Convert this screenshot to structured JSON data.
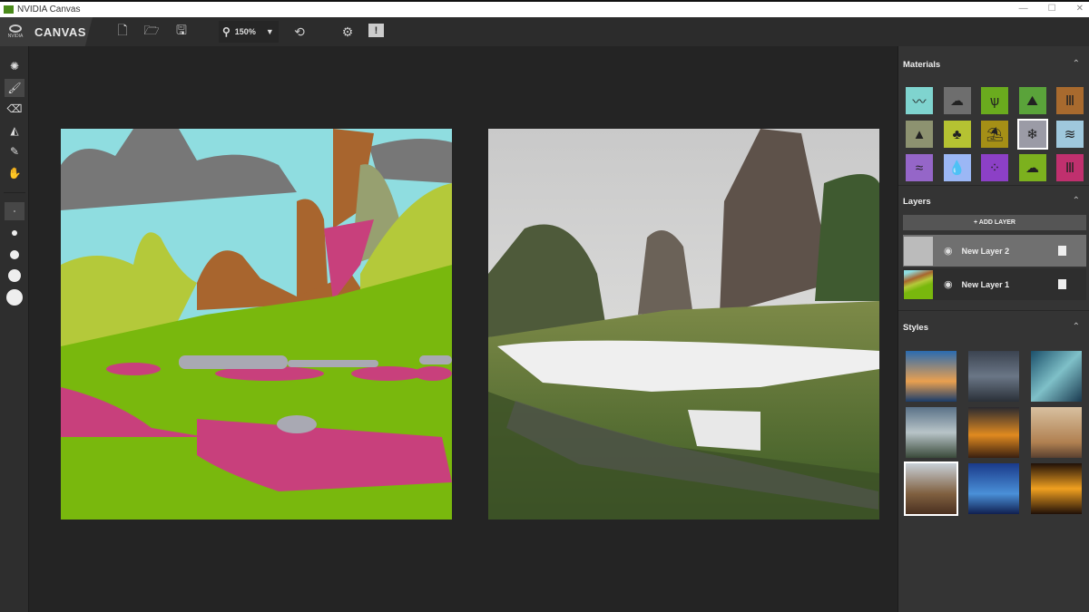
{
  "window": {
    "title": "NVIDIA Canvas",
    "controls": [
      "—",
      "☐",
      "✕"
    ]
  },
  "toolbar": {
    "brand": "NVIDIA",
    "app_name": "CANVAS",
    "zoom_level": "150%",
    "icons": [
      "new-file-icon",
      "open-folder-icon",
      "save-icon",
      "search-icon",
      "reset-icon",
      "gear-icon",
      "feedback-icon"
    ]
  },
  "left_tools": {
    "tools": [
      "material-icon",
      "brush-icon",
      "eraser-icon",
      "fill-bucket-icon",
      "eyedropper-icon",
      "hand-icon"
    ],
    "selected_tool": "brush",
    "brush_sizes": 5,
    "selected_brush_size": 1
  },
  "panel": {
    "materials": {
      "title": "Materials",
      "items": [
        {
          "name": "sky",
          "color": "#7fd4cf",
          "glyph": "〰"
        },
        {
          "name": "cloud",
          "color": "#6e6e6e",
          "glyph": "☁"
        },
        {
          "name": "grass",
          "color": "#6aab1e",
          "glyph": "ѱ"
        },
        {
          "name": "bush",
          "color": "#5aa33a",
          "glyph": "⛰"
        },
        {
          "name": "cliff",
          "color": "#a86a2e",
          "glyph": "Ⅲ"
        },
        {
          "name": "mountain",
          "color": "#8d9270",
          "glyph": "▲"
        },
        {
          "name": "tree",
          "color": "#b5c232",
          "glyph": "♣"
        },
        {
          "name": "beach",
          "color": "#a58f16",
          "glyph": "⛱"
        },
        {
          "name": "snow",
          "color": "#9b9ba6",
          "glyph": "❄"
        },
        {
          "name": "sea",
          "color": "#9fc8dc",
          "glyph": "≋"
        },
        {
          "name": "river",
          "color": "#9566c8",
          "glyph": "≈"
        },
        {
          "name": "water",
          "color": "#9bb7f5",
          "glyph": "💧"
        },
        {
          "name": "flowers",
          "color": "#8c40c6",
          "glyph": "⁘"
        },
        {
          "name": "fog",
          "color": "#7cb11e",
          "glyph": "☁"
        },
        {
          "name": "rock",
          "color": "#c0306e",
          "glyph": "Ⅲ"
        }
      ],
      "selected": "snow"
    },
    "layers": {
      "title": "Layers",
      "add_label": "+ ADD LAYER",
      "items": [
        {
          "name": "New Layer 2",
          "selected": true
        },
        {
          "name": "New Layer 1",
          "selected": false
        }
      ]
    },
    "styles": {
      "title": "Styles",
      "count": 9,
      "selected": 6
    }
  },
  "colors": {
    "sky": "#8fdde0",
    "cloud": "#777777",
    "cliff": "#a8652e",
    "grass": "#79b80d",
    "tree": "#b4c93a",
    "rock": "#c8407c",
    "snow": "#a9a9b3"
  }
}
